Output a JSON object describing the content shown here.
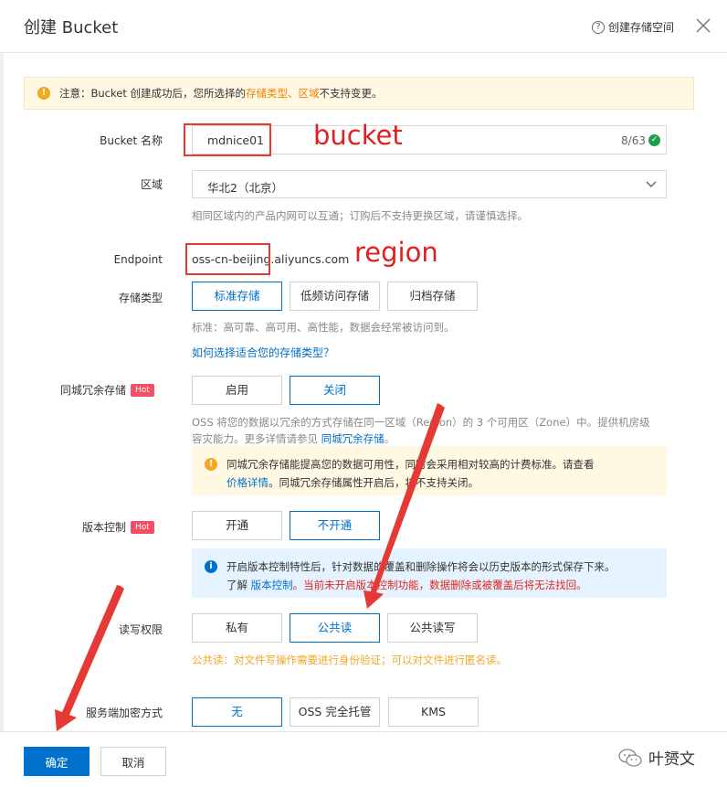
{
  "dialog": {
    "title": "创建 Bucket",
    "help_label": "创建存储空间"
  },
  "notice": {
    "prefix": "注意：Bucket 创建成功后，您所选择的 ",
    "highlight1": "存储类型",
    "sep": "、",
    "highlight2": "区域",
    "suffix": " 不支持变更。"
  },
  "bucket_name": {
    "label": "Bucket 名称",
    "value": "mdnice01",
    "counter": "8/63"
  },
  "region": {
    "label": "区域",
    "value": "华北2（北京）",
    "help": "相同区域内的产品内网可以互通；订购后不支持更换区域，请谨慎选择。"
  },
  "endpoint": {
    "label": "Endpoint",
    "value": "oss-cn-beijing.aliyuncs.com"
  },
  "storage_type": {
    "label": "存储类型",
    "options": [
      "标准存储",
      "低频访问存储",
      "归档存储"
    ],
    "selected": "标准存储",
    "help": "标准：高可靠、高可用、高性能，数据会经常被访问到。",
    "link": "如何选择适合您的存储类型？"
  },
  "redundancy": {
    "label": "同城冗余存储",
    "hot": "Hot",
    "options": [
      "启用",
      "关闭"
    ],
    "selected": "关闭",
    "help_line1": "OSS 将您的数据以冗余的方式存储在同一区域（Region）的 3 个可用区（Zone）中。提供机房级",
    "help_line2_prefix": "容灾能力。更多详情请参见 ",
    "help_link": "同城冗余存储",
    "help_line2_suffix": "。",
    "warn_line1": "同城冗余存储能提高您的数据可用性，同时会采用相对较高的计费标准。请查看",
    "warn_link": "价格详情",
    "warn_line2": "。同城冗余存储属性开启后，将不支持关闭。"
  },
  "versioning": {
    "label": "版本控制",
    "hot": "Hot",
    "options": [
      "开通",
      "不开通"
    ],
    "selected": "不开通",
    "info_line1": "开启版本控制特性后，针对数据的覆盖和删除操作将会以历史版本的形式保存下来。",
    "info_prefix": "了解 ",
    "info_link": "版本控制",
    "info_warning": "。当前未开启版本控制功能，数据删除或被覆盖后将无法找回。"
  },
  "acl": {
    "label": "读写权限",
    "options": [
      "私有",
      "公共读",
      "公共读写"
    ],
    "selected": "公共读",
    "warning": "公共读：对文件写操作需要进行身份验证；可以对文件进行匿名读。"
  },
  "encryption": {
    "label": "服务端加密方式",
    "options": [
      "无",
      "OSS 完全托管",
      "KMS"
    ],
    "selected": "无"
  },
  "footer": {
    "confirm": "确定",
    "cancel": "取消"
  },
  "watermark": "叶赟文",
  "annotations": {
    "bucket": "bucket",
    "region": "region",
    "color": "#e02020"
  },
  "colors": {
    "primary": "#0070cc",
    "warning": "#f5a623",
    "hot": "#f34e62",
    "success": "#1e9e4a"
  }
}
